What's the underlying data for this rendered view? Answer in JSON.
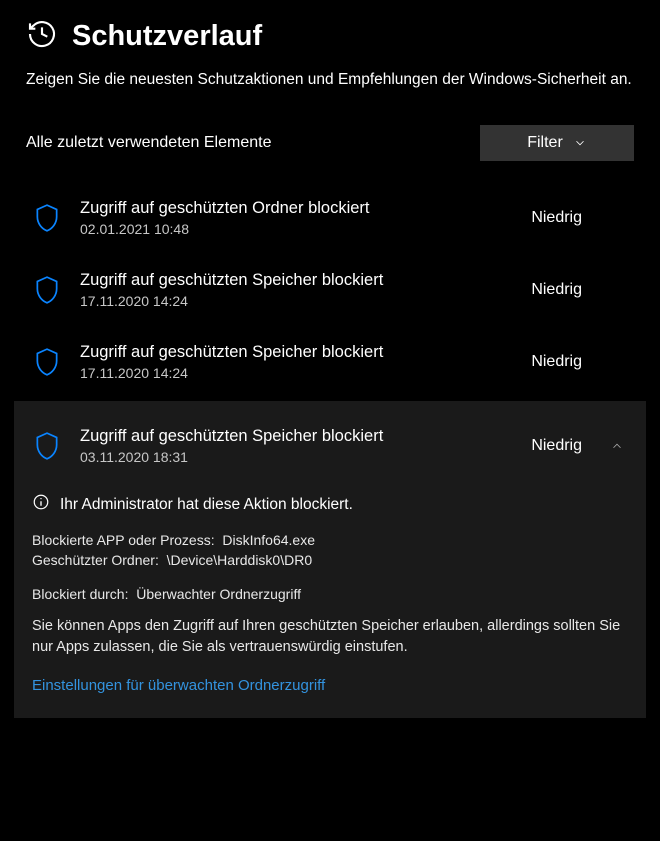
{
  "header": {
    "title": "Schutzverlauf",
    "subtitle": "Zeigen Sie die neuesten Schutzaktionen und Empfehlungen der Windows-Sicherheit an."
  },
  "toolbar": {
    "recent_label": "Alle zuletzt verwendeten Elemente",
    "filter_label": "Filter"
  },
  "items": [
    {
      "title": "Zugriff auf geschützten Ordner blockiert",
      "timestamp": "02.01.2021 10:48",
      "severity": "Niedrig"
    },
    {
      "title": "Zugriff auf geschützten Speicher blockiert",
      "timestamp": "17.11.2020 14:24",
      "severity": "Niedrig"
    },
    {
      "title": "Zugriff auf geschützten Speicher blockiert",
      "timestamp": "17.11.2020 14:24",
      "severity": "Niedrig"
    },
    {
      "title": "Zugriff auf geschützten Speicher blockiert",
      "timestamp": "03.11.2020 18:31",
      "severity": "Niedrig"
    }
  ],
  "details": {
    "admin_msg": "Ihr Administrator hat diese Aktion blockiert.",
    "blocked_app_label": "Blockierte APP oder Prozess:",
    "blocked_app_value": "DiskInfo64.exe",
    "protected_folder_label": "Geschützter Ordner:",
    "protected_folder_value": "\\Device\\Harddisk0\\DR0",
    "blocked_by_label": "Blockiert durch:",
    "blocked_by_value": "Überwachter Ordnerzugriff",
    "description": "Sie können Apps den Zugriff auf Ihren geschützten Speicher erlauben, allerdings sollten Sie nur Apps zulassen, die Sie als vertrauenswürdig einstufen.",
    "settings_link": "Einstellungen für überwachten Ordnerzugriff"
  }
}
